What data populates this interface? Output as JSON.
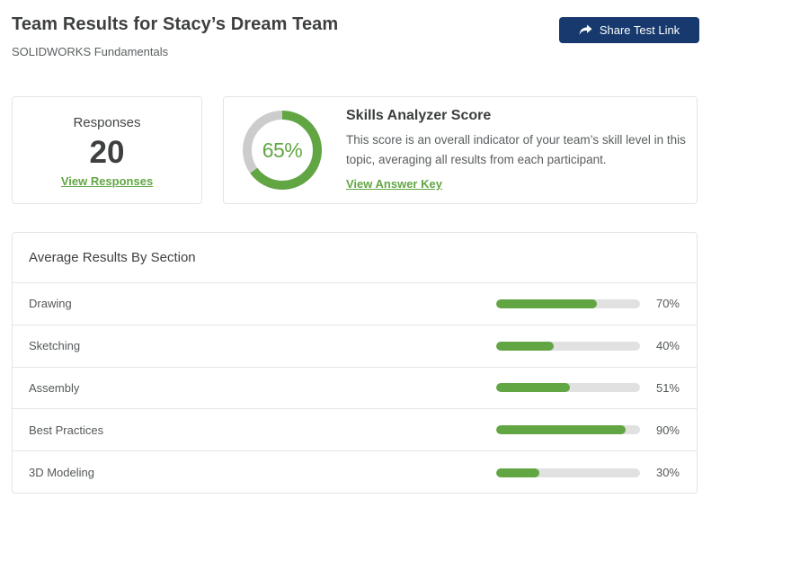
{
  "header": {
    "title": "Team Results for Stacy’s Dream Team",
    "subtitle": "SOLIDWORKS Fundamentals",
    "share_button_label": "Share Test Link",
    "share_icon": "forward-arrow"
  },
  "responses_card": {
    "title": "Responses",
    "count": "20",
    "link_label": "View Responses"
  },
  "score_card": {
    "title": "Skills Analyzer Score",
    "description": "This score is an overall indicator of your team’s skill level in this topic, averaging all results from each participant.",
    "link_label": "View Answer Key",
    "score_percent": 65,
    "score_label": "65%"
  },
  "sections_card": {
    "title": "Average Results By Section",
    "rows": [
      {
        "label": "Drawing",
        "percent": 70,
        "percent_label": "70%"
      },
      {
        "label": "Sketching",
        "percent": 40,
        "percent_label": "40%"
      },
      {
        "label": "Assembly",
        "percent": 51,
        "percent_label": "51%"
      },
      {
        "label": "Best Practices",
        "percent": 90,
        "percent_label": "90%"
      },
      {
        "label": "3D Modeling",
        "percent": 30,
        "percent_label": "30%"
      }
    ]
  },
  "colors": {
    "green": "#62a644",
    "navy": "#17396d",
    "donut_track": "#cccccc",
    "bar_track": "#e1e1e1"
  }
}
